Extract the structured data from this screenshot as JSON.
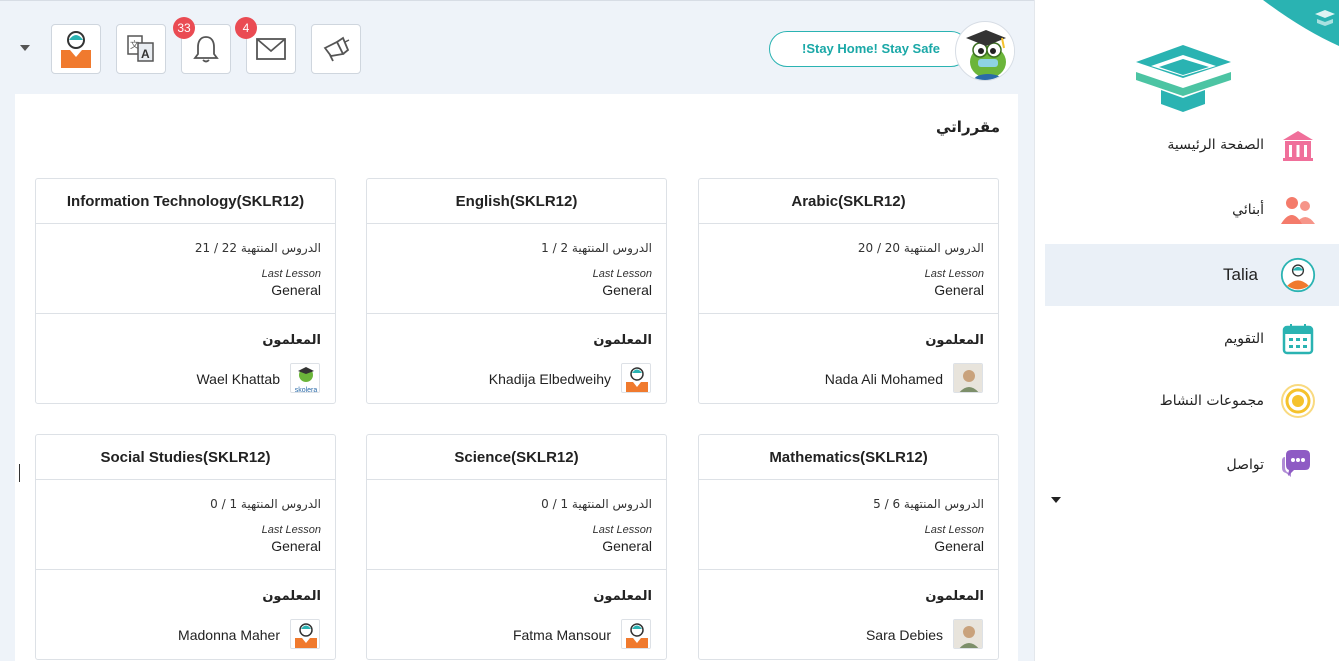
{
  "topbar": {
    "notifications_count": "33",
    "messages_count": "4",
    "stay_home_text": "!Stay Home! Stay Safe"
  },
  "main": {
    "title": "مقرراتي",
    "courses": [
      {
        "title": "Arabic(SKLR12)",
        "progress": "الدروس المنتهية 20 / 20",
        "last_label": "Last Lesson",
        "last_value": "General",
        "teacher_label": "المعلمون",
        "teacher": "Nada Ali Mohamed",
        "teacher_avatar": "photo"
      },
      {
        "title": "English(SKLR12)",
        "progress": "الدروس المنتهية 2 / 1",
        "last_label": "Last Lesson",
        "last_value": "General",
        "teacher_label": "المعلمون",
        "teacher": "Khadija Elbedweihy",
        "teacher_avatar": "avatar"
      },
      {
        "title": "Information Technology(SKLR12)",
        "progress": "الدروس المنتهية 22 / 21",
        "last_label": "Last Lesson",
        "last_value": "General",
        "teacher_label": "المعلمون",
        "teacher": "Wael Khattab",
        "teacher_avatar": "skolera"
      },
      {
        "title": "Mathematics(SKLR12)",
        "progress": "الدروس المنتهية 6 / 5",
        "last_label": "Last Lesson",
        "last_value": "General",
        "teacher_label": "المعلمون",
        "teacher": "Sara Debies",
        "teacher_avatar": "photo"
      },
      {
        "title": "Science(SKLR12)",
        "progress": "الدروس المنتهية 1 / 0",
        "last_label": "Last Lesson",
        "last_value": "General",
        "teacher_label": "المعلمون",
        "teacher": "Fatma Mansour",
        "teacher_avatar": "avatar"
      },
      {
        "title": "Social Studies(SKLR12)",
        "progress": "الدروس المنتهية 1 / 0",
        "last_label": "Last Lesson",
        "last_value": "General",
        "teacher_label": "المعلمون",
        "teacher": "Madonna Maher",
        "teacher_avatar": "avatar"
      }
    ],
    "skolera_logo_text": "skolera"
  },
  "sidebar": {
    "items": [
      {
        "label": "الصفحة الرئيسية",
        "icon": "school-building-icon",
        "color": "#f06f9a"
      },
      {
        "label": "أبنائي",
        "icon": "children-icon",
        "color": "#f47b6b"
      },
      {
        "label": "Talia",
        "icon": "student-avatar-icon",
        "color": "#2ab3b2"
      },
      {
        "label": "التقويم",
        "icon": "calendar-icon",
        "color": "#2ab3b2"
      },
      {
        "label": "مجموعات النشاط",
        "icon": "activity-target-icon",
        "color": "#f5c22c"
      },
      {
        "label": "تواصل",
        "icon": "chat-bubbles-icon",
        "color": "#8e5bc4"
      }
    ]
  },
  "colors": {
    "brand_teal": "#2ab3b2",
    "badge_red": "#ea4b53",
    "active_bg": "#eaf0f7"
  }
}
